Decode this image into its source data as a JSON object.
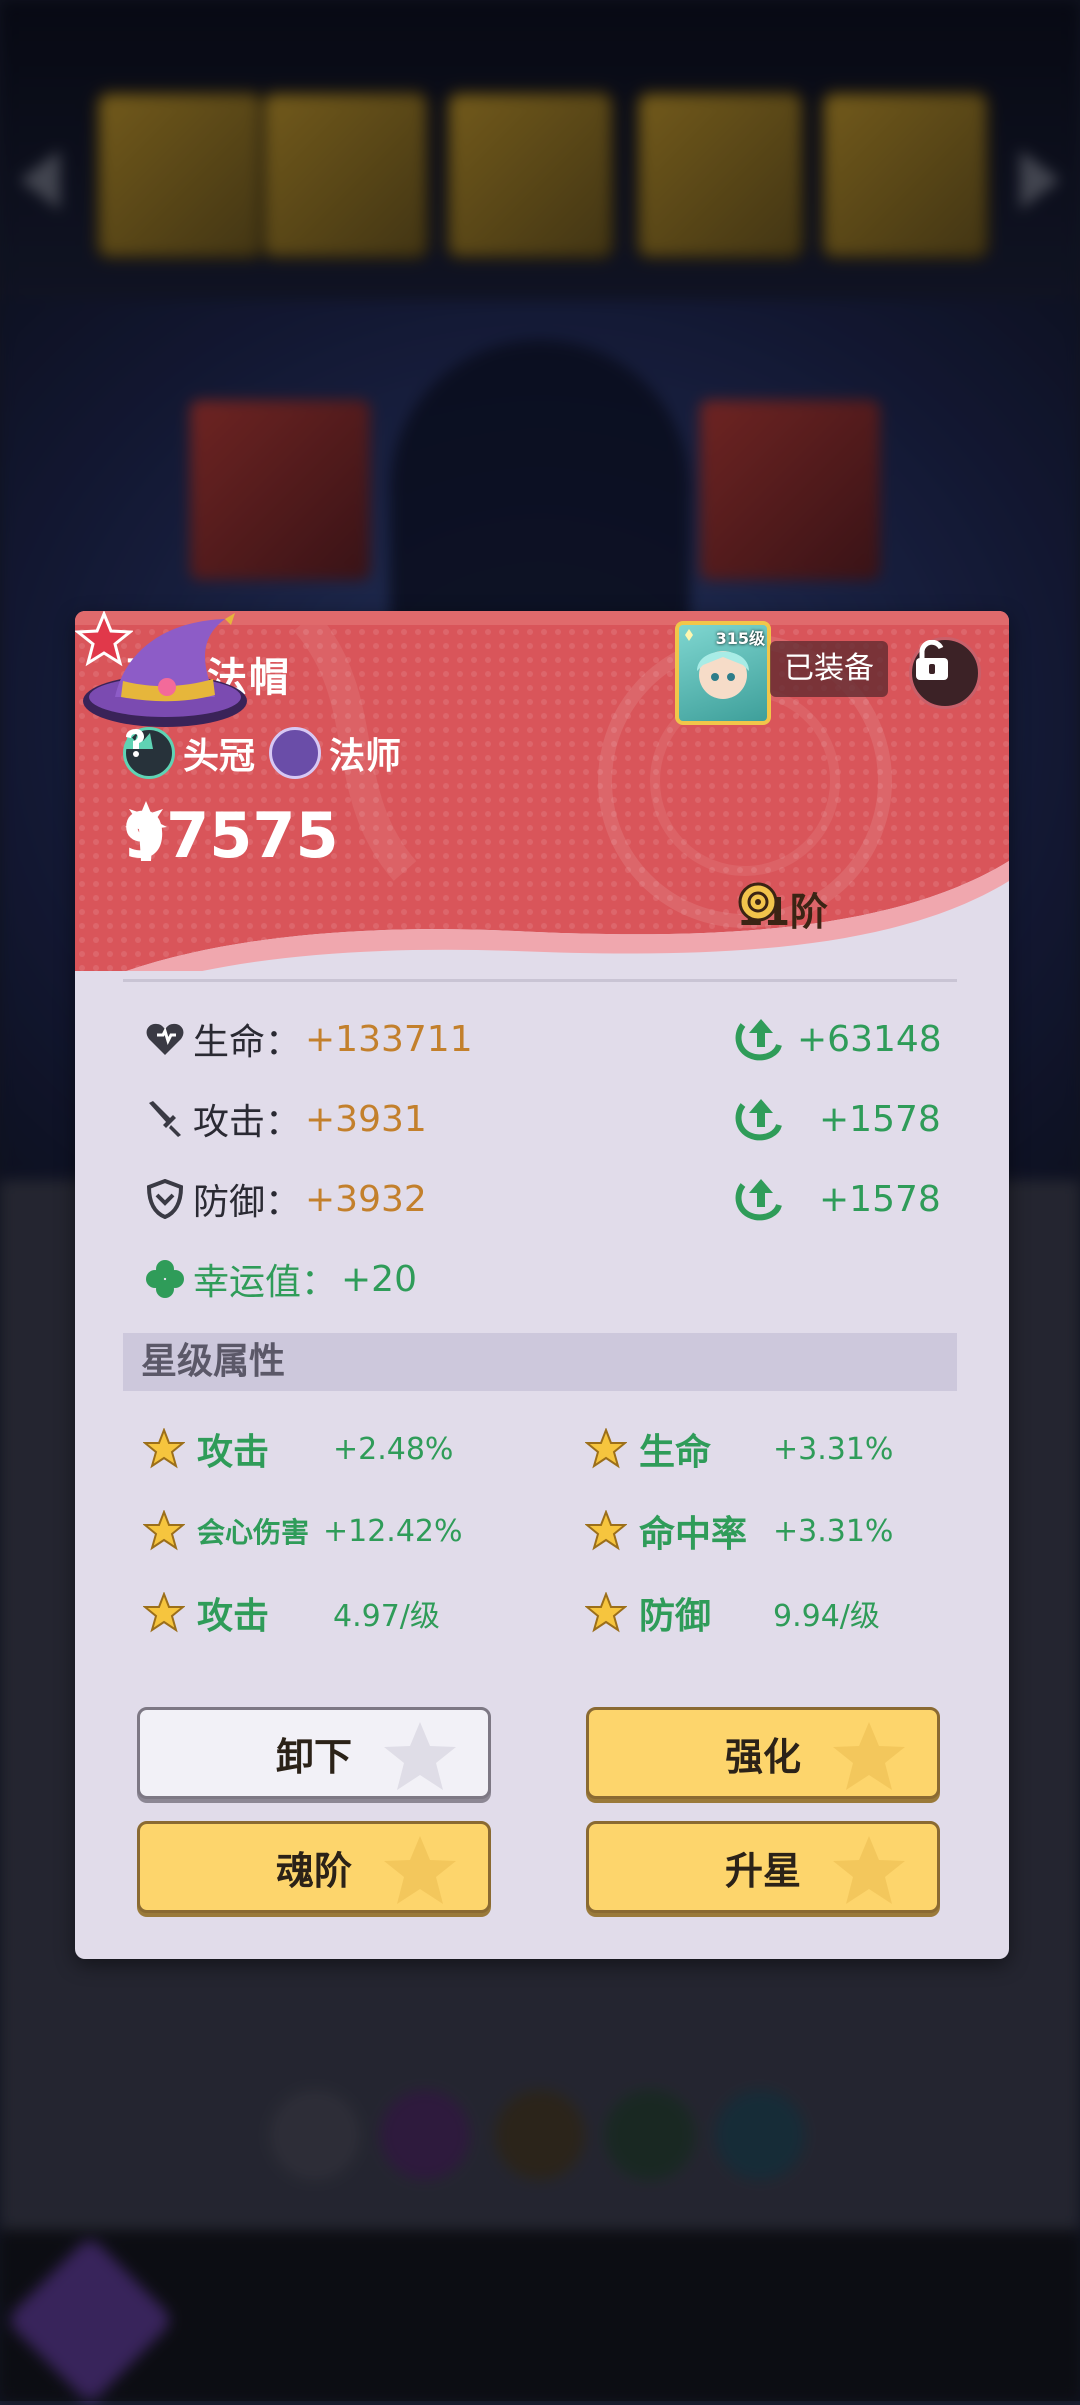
{
  "item": {
    "name": "灵源法帽",
    "equipped_label": "已装备",
    "hero_level": "315级",
    "slot": "头冠",
    "class": "法师",
    "power": "97575",
    "tier": "11阶",
    "star_count": 1
  },
  "stats": [
    {
      "icon": "heart-icon",
      "name": "生命：",
      "value": "+133711",
      "bonus": "+63148"
    },
    {
      "icon": "sword-icon",
      "name": "攻击：",
      "value": "+3931",
      "bonus": "+1578"
    },
    {
      "icon": "shield-icon",
      "name": "防御：",
      "value": "+3932",
      "bonus": "+1578"
    }
  ],
  "lucky": {
    "name": "幸运值：",
    "value": "+20"
  },
  "star_section_title": "星级属性",
  "star_attrs": [
    {
      "name": "攻击",
      "value": "+2.48%"
    },
    {
      "name": "生命",
      "value": "+3.31%"
    },
    {
      "name": "会心伤害",
      "value": "+12.42%"
    },
    {
      "name": "命中率",
      "value": "+3.31%"
    },
    {
      "name": "攻击",
      "value": "4.97/级"
    },
    {
      "name": "防御",
      "value": "9.94/级"
    }
  ],
  "buttons": {
    "unequip": "卸下",
    "enhance": "强化",
    "soul_tier": "魂阶",
    "star_up": "升星"
  },
  "colors": {
    "header_red": "#d9555a",
    "card_bg": "#e1dcea",
    "stat_gold": "#c3802c",
    "stat_green": "#2f9c59",
    "button_yellow": "#fdd56c"
  }
}
